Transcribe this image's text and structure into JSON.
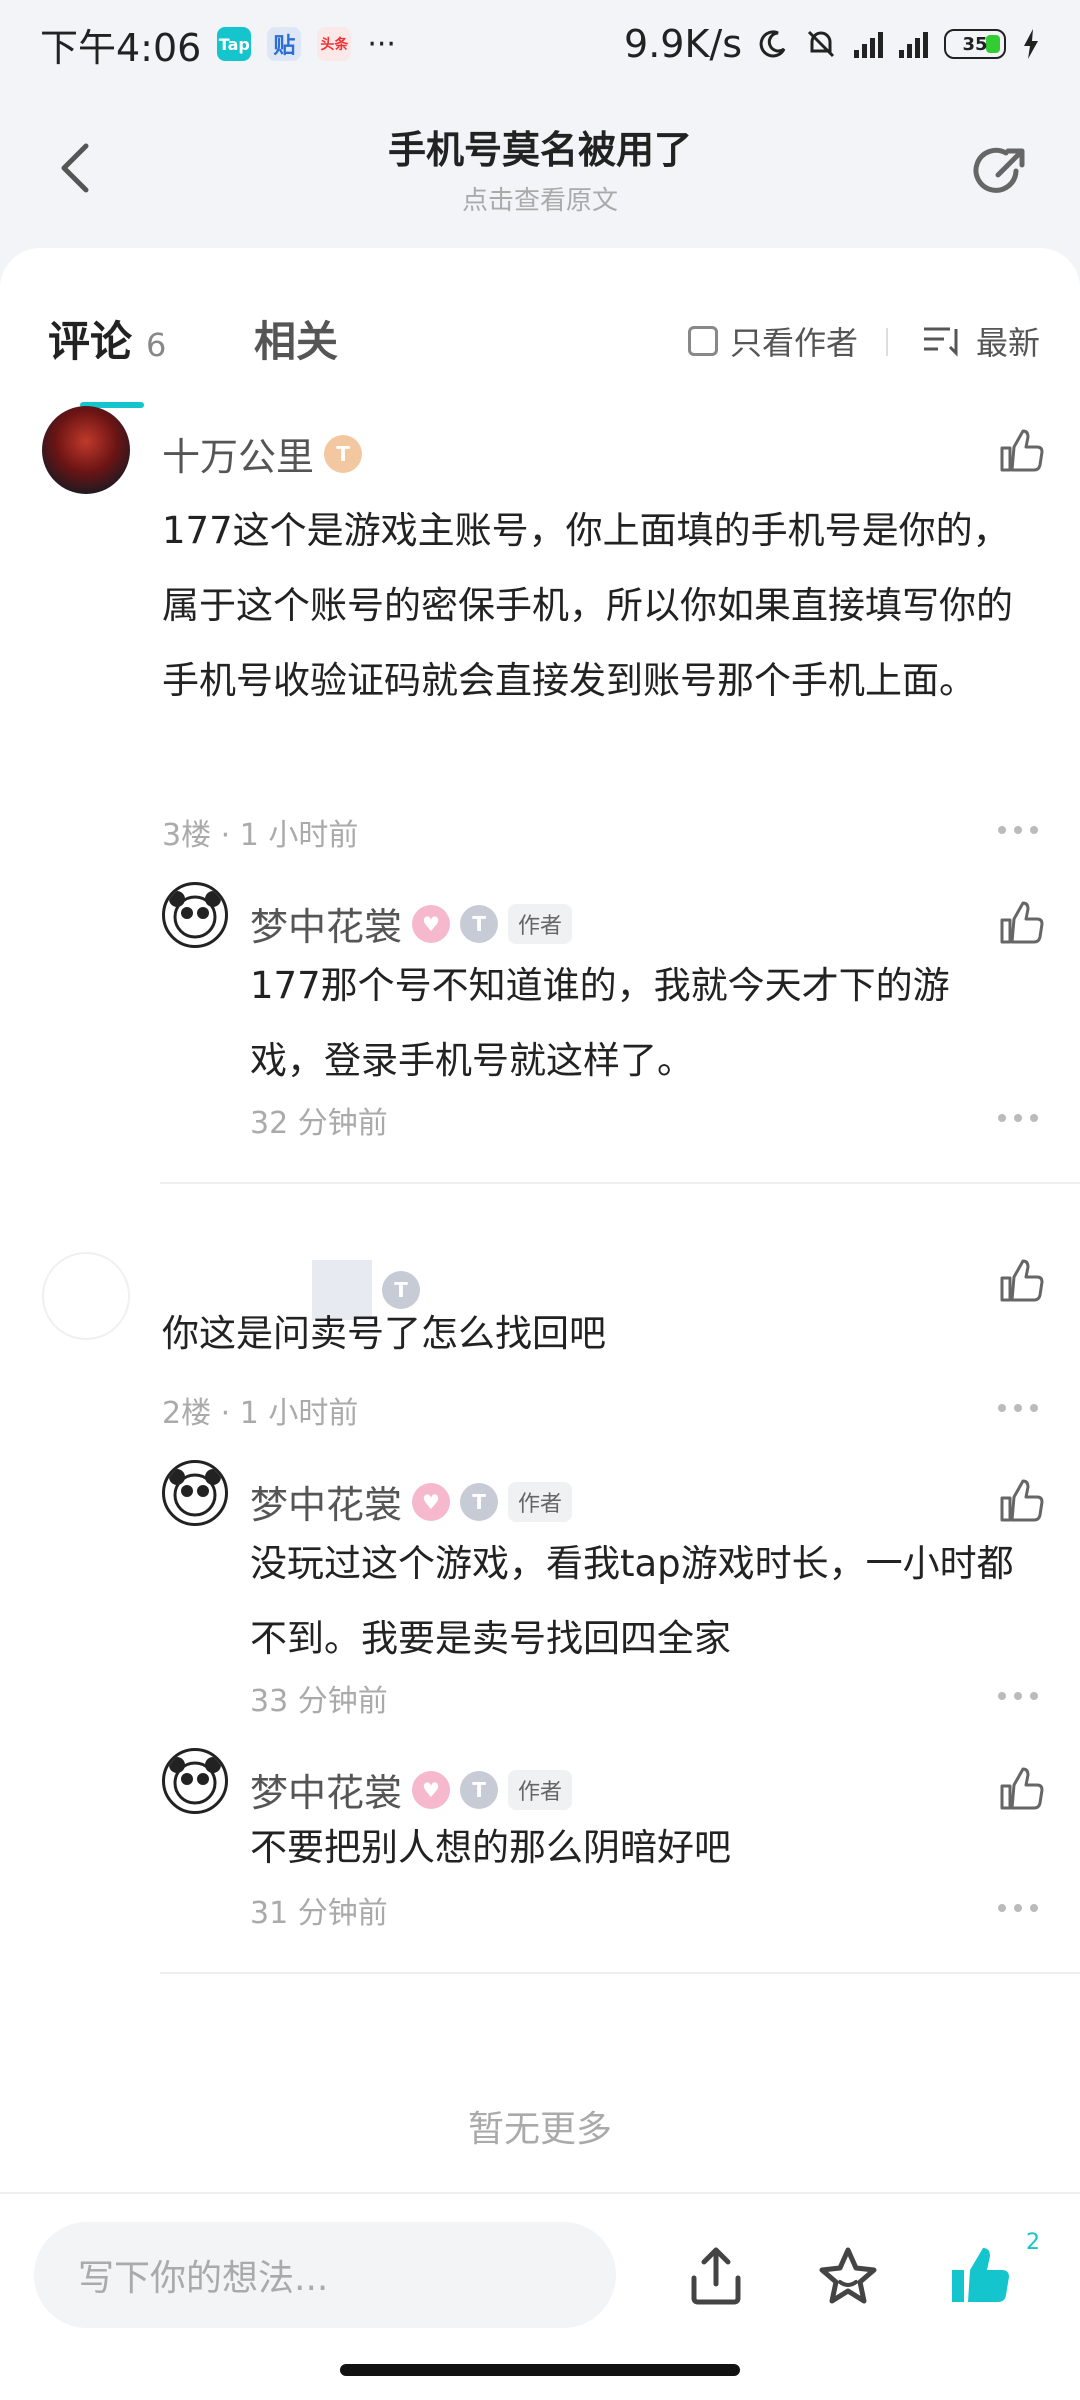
{
  "status_bar": {
    "time": "下午4:06",
    "app_badges": [
      "Tap",
      "贴",
      "头条"
    ],
    "more": "···",
    "net_speed": "9.9K/s",
    "battery": "35"
  },
  "header": {
    "title": "手机号莫名被用了",
    "subtitle": "点击查看原文"
  },
  "tabs": {
    "comments_label": "评论",
    "comments_count": "6",
    "related_label": "相关",
    "author_only": "只看作者",
    "sort": "最新"
  },
  "comments": [
    {
      "user": "十万公里",
      "text": "177这个是游戏主账号，你上面填的手机号是你的，属于这个账号的密保手机，所以你如果直接填写你的手机号收验证码就会直接发到账号那个手机上面。",
      "floor": "3楼",
      "time": "1 小时前",
      "replies": [
        {
          "user": "梦中花裳",
          "tag": "作者",
          "text": "177那个号不知道谁的，我就今天才下的游戏，登录手机号就这样了。",
          "time": "32 分钟前"
        }
      ]
    },
    {
      "user": "",
      "text": "你这是问卖号了怎么找回吧",
      "floor": "2楼",
      "time": "1 小时前",
      "replies": [
        {
          "user": "梦中花裳",
          "tag": "作者",
          "text": "没玩过这个游戏，看我tap游戏时长，一小时都不到。我要是卖号找回四全家",
          "time": "33 分钟前"
        },
        {
          "user": "梦中花裳",
          "tag": "作者",
          "text": "不要把别人想的那么阴暗好吧",
          "time": "31 分钟前"
        }
      ]
    }
  ],
  "meta_sep": "·",
  "no_more": "暂无更多",
  "bottom_bar": {
    "input_placeholder": "写下你的想法...",
    "like_count": "2"
  },
  "colors": {
    "accent": "#15c5ce",
    "text": "#222222",
    "muted": "#aaaaaa"
  }
}
